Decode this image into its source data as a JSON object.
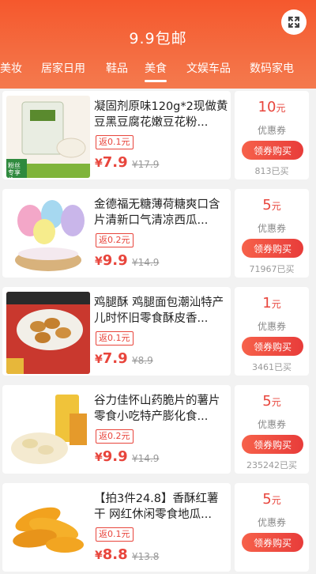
{
  "header": {
    "title": "9.9包邮",
    "tabs": [
      {
        "label": "美妆",
        "active": false
      },
      {
        "label": "居家日用",
        "active": false
      },
      {
        "label": "鞋品",
        "active": false
      },
      {
        "label": "美食",
        "active": true
      },
      {
        "label": "文娱车品",
        "active": false
      },
      {
        "label": "数码家电",
        "active": false
      }
    ],
    "colors": {
      "brand": "#f5582d",
      "accent": "#e8453c"
    }
  },
  "products": [
    {
      "name": "凝固剂原味120g*2现做黄豆黑豆腐花嫩豆花粉...",
      "rebate": "返0.1元",
      "price_symbol": "¥",
      "price": "7.9",
      "original_price": "¥17.9",
      "coupon_amount": "10",
      "coupon_unit": "元",
      "coupon_label": "优惠券",
      "buy_label": "领券购买",
      "sold": "813已买",
      "thumb_badge": "粉丝专享价"
    },
    {
      "name": "金德福无糖薄荷糖爽口含片清新口气清凉西瓜...",
      "rebate": "返0.2元",
      "price_symbol": "¥",
      "price": "9.9",
      "original_price": "¥14.9",
      "coupon_amount": "5",
      "coupon_unit": "元",
      "coupon_label": "优惠券",
      "buy_label": "领券购买",
      "sold": "71967已买"
    },
    {
      "name": "鸡腿酥 鸡腿面包潮汕特产儿时怀旧零食酥皮香...",
      "rebate": "返0.1元",
      "price_symbol": "¥",
      "price": "7.9",
      "original_price": "¥8.9",
      "coupon_amount": "1",
      "coupon_unit": "元",
      "coupon_label": "优惠券",
      "buy_label": "领券购买",
      "sold": "3461已买"
    },
    {
      "name": "谷力佳怀山药脆片的薯片零食小吃特产膨化食...",
      "rebate": "返0.2元",
      "price_symbol": "¥",
      "price": "9.9",
      "original_price": "¥14.9",
      "coupon_amount": "5",
      "coupon_unit": "元",
      "coupon_label": "优惠券",
      "buy_label": "领券购买",
      "sold": "235242已买"
    },
    {
      "name": "【拍3件24.8】香酥红薯干 网红休闲零食地瓜...",
      "rebate": "返0.1元",
      "price_symbol": "¥",
      "price": "8.8",
      "original_price": "¥13.8",
      "coupon_amount": "5",
      "coupon_unit": "元",
      "coupon_label": "优惠券",
      "buy_label": "领券购买",
      "sold": ""
    }
  ]
}
